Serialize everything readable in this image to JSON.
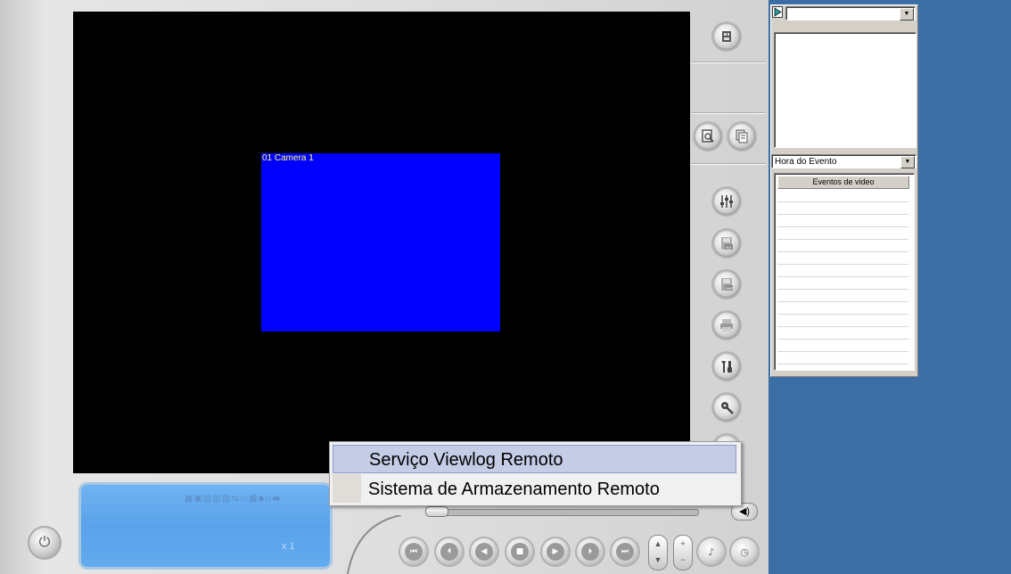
{
  "video": {
    "cameras": [
      {
        "label": "01 Camera 1",
        "color": "#0000ff"
      }
    ]
  },
  "right_panel": {
    "top_combo": {
      "value": ""
    },
    "sort_combo": {
      "value": "Hora do Evento"
    },
    "events_table": {
      "header": "Eventos de video",
      "rows": []
    }
  },
  "context_menu": {
    "items": [
      {
        "label": "Serviço Viewlog Remoto",
        "selected": true
      },
      {
        "label": "Sistema de Armazenamento Remoto",
        "selected": false
      }
    ]
  },
  "lcd": {
    "icons": "▦▣▤▥▧⇆▭▩▪▫▬",
    "speed": "x 1"
  },
  "side_buttons": [
    "layout-icon",
    "search-icon",
    "copy-icon",
    "mixer-icon",
    "save-avi-icon",
    "save-bmp-icon",
    "print-icon",
    "tools-icon",
    "settings-icon"
  ],
  "playback_buttons": [
    "skip-start-icon",
    "previous-frame-icon",
    "rewind-icon",
    "stop-icon",
    "play-icon",
    "next-frame-icon",
    "skip-end-icon"
  ],
  "colors": {
    "desktop": "#3a6ea5",
    "menu_highlight": "#c5cce6",
    "lcd": "#5aa2ea"
  }
}
